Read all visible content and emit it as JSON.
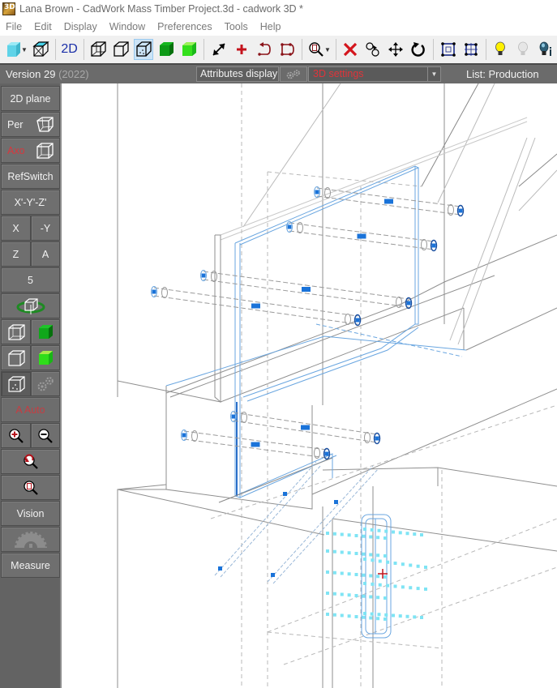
{
  "window": {
    "title": "Lana Brown - CadWork Mass Timber Project.3d - cadwork 3D *"
  },
  "menu": {
    "items": [
      "File",
      "Edit",
      "Display",
      "Window",
      "Preferences",
      "Tools",
      "Help"
    ]
  },
  "toolbar": {
    "view_2d_label": "2D",
    "buttons": [
      "shaded-cube-icon",
      "cube-top-highlight-icon",
      "2d-view",
      "wireframe-cube-icon",
      "hidden-line-cube-icon",
      "hidden-line-dots-cube-icon",
      "solid-green-cube-icon",
      "light-green-cube-icon",
      "diagonal-arrow-icon",
      "red-plus-icon",
      "connect-arrow-icon",
      "rectangle-arrows-icon",
      "zoom-page-icon",
      "red-x-icon",
      "select-circles-icon",
      "move-icon",
      "rotate-icon",
      "frame-nodes-icon",
      "frame-nodes-alt-icon",
      "lightbulb-on-icon",
      "lightbulb-off-icon",
      "lightbulb-info-icon"
    ]
  },
  "statusbar": {
    "version_label": "Version 29",
    "version_year": "(2022)",
    "attributes_display_label": "Attributes display",
    "settings_value": "3D settings",
    "list_label": "List: Production"
  },
  "leftpanel": {
    "plane_2d": "2D plane",
    "per": "Per",
    "axo": "Axo",
    "refswitch": "RefSwitch",
    "xyz": "X'-Y'-Z'",
    "x": "X",
    "neg_y": "-Y",
    "z": "Z",
    "a": "A",
    "five": "5",
    "auto": "A Auto",
    "vision": "Vision",
    "measure": "Measure"
  },
  "colors": {
    "accent_blue": "#1a73d9",
    "selection_cyan": "#7fe4f4",
    "panel_gray": "#636363",
    "warning_red": "#d8373d"
  }
}
